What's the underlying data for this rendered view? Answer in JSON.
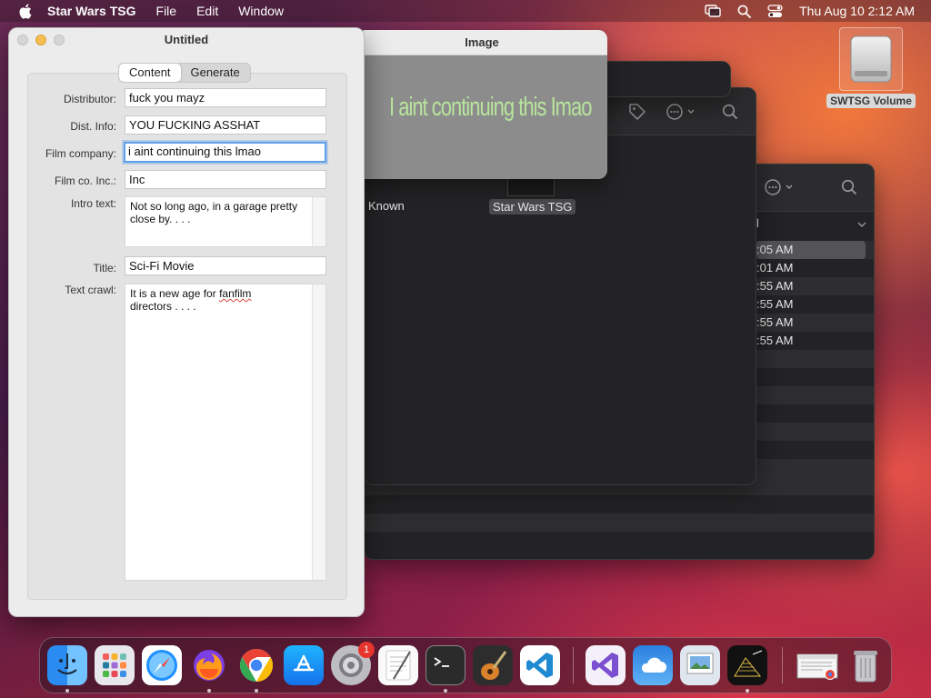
{
  "menubar": {
    "app_name": "Star Wars TSG",
    "menus": [
      "File",
      "Edit",
      "Window"
    ],
    "datetime": "Thu Aug 10  2:12 AM"
  },
  "desktop": {
    "volume_label": "SWTSG Volume"
  },
  "finder": {
    "item_known": "Known",
    "item_app": "Star Wars TSG",
    "column_header": "l",
    "times": [
      ":05 AM",
      ":01 AM",
      ":55 AM",
      ":55 AM",
      ":55 AM",
      ":55 AM"
    ]
  },
  "image_window": {
    "title": "Image",
    "crawl_text": "I aint continuing this Imao"
  },
  "main_window": {
    "title": "Untitled",
    "tabs": [
      "Content",
      "Generate"
    ],
    "fields": {
      "distributor_label": "Distributor:",
      "distributor_value": "fuck you mayz",
      "dist_info_label": "Dist. Info:",
      "dist_info_value": "YOU FUCKING ASSHAT",
      "film_company_label": "Film company:",
      "film_company_value": "i aint continuing this lmao",
      "film_co_inc_label": "Film co. Inc.:",
      "film_co_inc_value": "Inc",
      "intro_text_label": "Intro text:",
      "intro_text_value": "Not so long ago, in a garage pretty close by. . . .",
      "title_label": "Title:",
      "title_value": "Sci-Fi Movie",
      "text_crawl_label": "Text crawl:",
      "text_crawl_value_a": "It is a new age for ",
      "text_crawl_value_b": "fanfilm",
      "text_crawl_value_c": "directors . . . ."
    }
  },
  "dock": {
    "badge_count": "1",
    "apps": [
      "finder",
      "launchpad",
      "safari",
      "firefox",
      "chrome",
      "app-store",
      "system-settings",
      "textedit",
      "terminal",
      "garageband",
      "vscode",
      "visual-studio",
      "weather",
      "preview",
      "star-wars-tsg",
      "chrome-window",
      "trash"
    ]
  }
}
